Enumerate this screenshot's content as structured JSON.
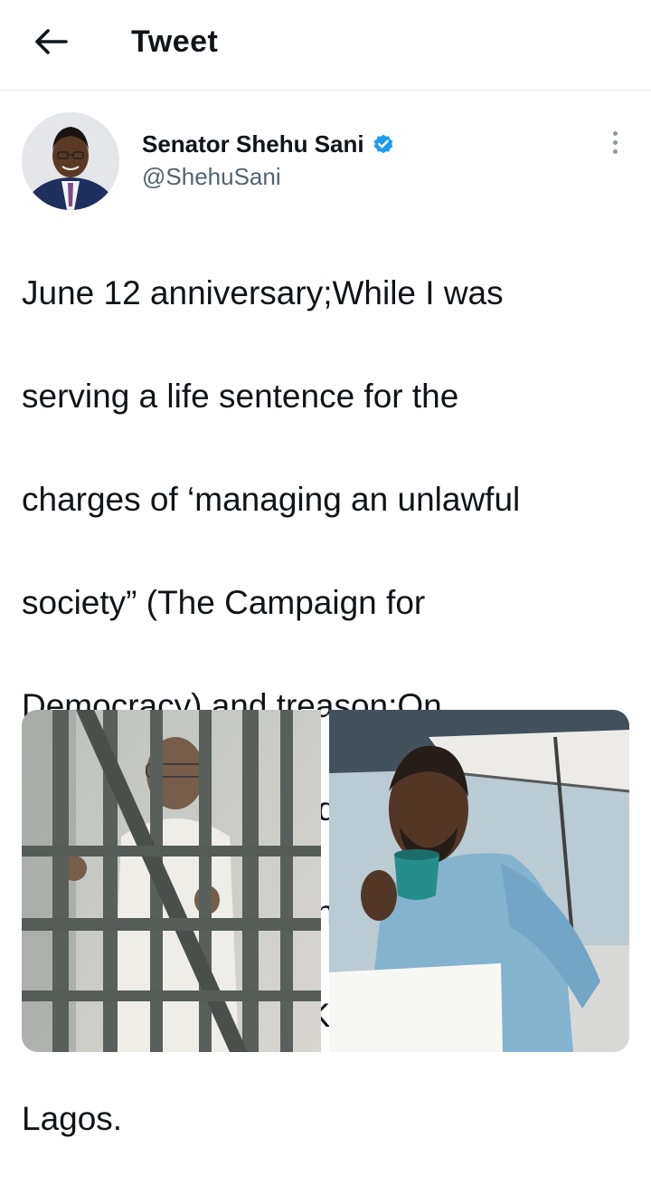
{
  "header": {
    "title": "Tweet",
    "back_icon": "arrow-left-icon"
  },
  "author": {
    "display_name": "Senator Shehu Sani",
    "handle": "@ShehuSani",
    "verified": true,
    "verified_color": "#1d9bf0"
  },
  "tweet": {
    "text_lines": [
      "June 12 anniversary;While I was",
      "serving a life sentence for the",
      "charges of ‘managing an unlawful",
      "society” (The Campaign for",
      "Democracy) and  treason;On",
      "the left was in J-ward,Aba",
      "Prison,Abia State.On the right",
      "was in block 2 Cell,Kiri Kiri Prison",
      "Lagos."
    ]
  },
  "media": [
    {
      "name": "photo-prison-bars",
      "description_icon": "photo"
    },
    {
      "name": "photo-cell-cup",
      "description_icon": "photo"
    }
  ],
  "colors": {
    "text": "#0f1419",
    "secondary_text": "#536471",
    "accent": "#1d9bf0",
    "divider": "#e6e6e6"
  }
}
